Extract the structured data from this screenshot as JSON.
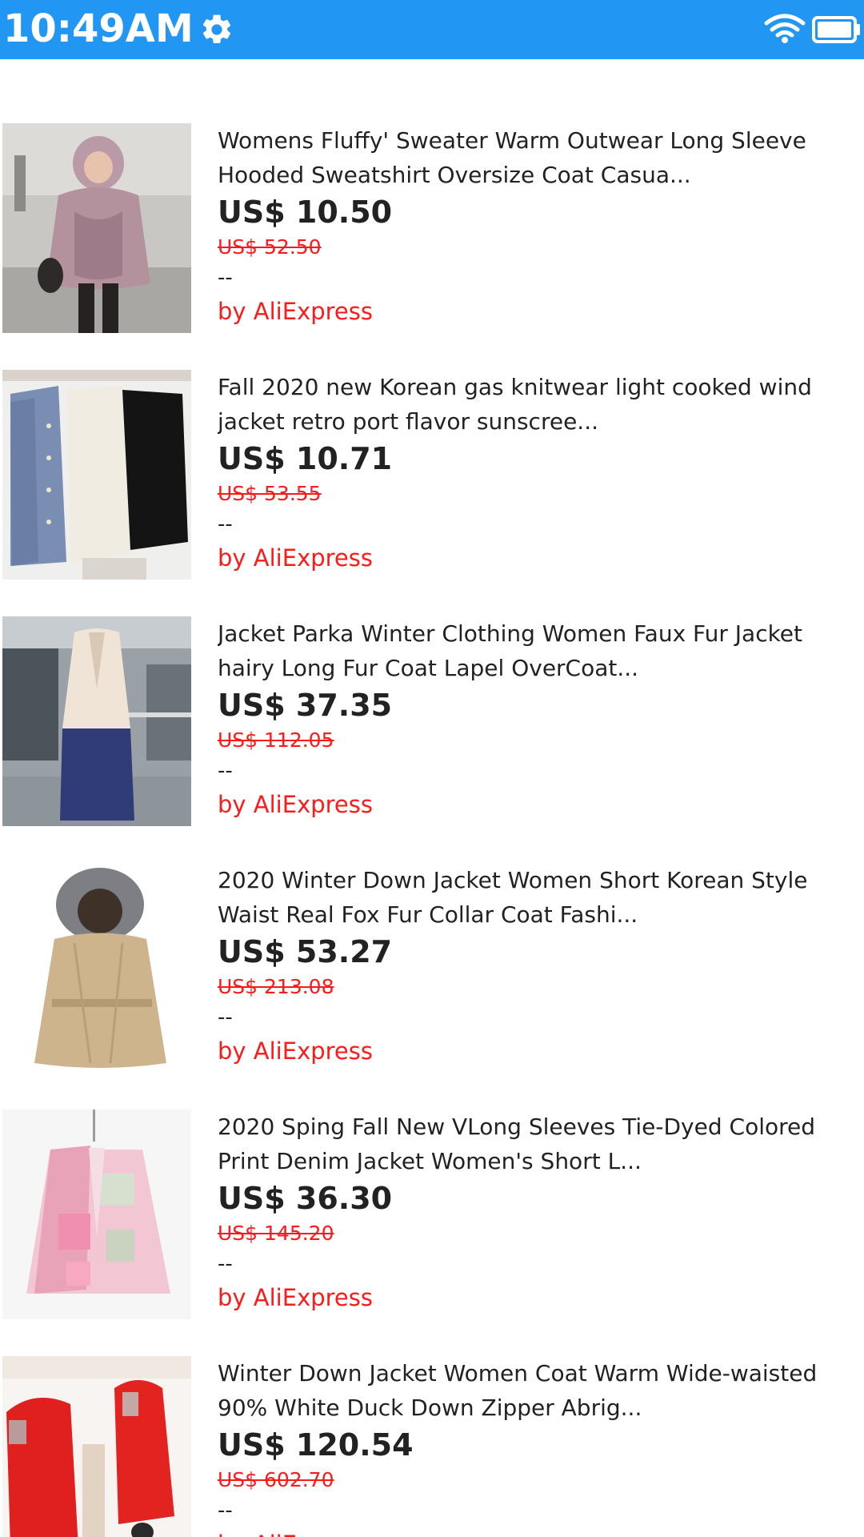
{
  "status_bar": {
    "time": "10:49AM",
    "background": "#2196f3",
    "icons": [
      "gear-icon",
      "wifi-icon",
      "battery-icon"
    ]
  },
  "colors": {
    "price_accent": "#ff1a1a",
    "text": "#222222"
  },
  "products": [
    {
      "title": "Womens Fluffy' Sweater Warm Outwear Long Sleeve Hooded Sweatshirt Oversize Coat Casua...",
      "price": "US$ 10.50",
      "original_price": "US$ 52.50",
      "discount": "--",
      "seller": "by AliExpress"
    },
    {
      "title": "Fall 2020 new Korean gas knitwear light cooked wind jacket retro port flavor sunscree...",
      "price": "US$ 10.71",
      "original_price": "US$ 53.55",
      "discount": "--",
      "seller": "by AliExpress"
    },
    {
      "title": "Jacket Parka Winter Clothing Women Faux Fur Jacket hairy Long Fur Coat Lapel OverCoat...",
      "price": "US$ 37.35",
      "original_price": "US$ 112.05",
      "discount": "--",
      "seller": "by AliExpress"
    },
    {
      "title": "2020 Winter Down Jacket Women Short Korean Style Waist Real Fox Fur Collar Coat Fashi...",
      "price": "US$ 53.27",
      "original_price": "US$ 213.08",
      "discount": "--",
      "seller": "by AliExpress"
    },
    {
      "title": "2020 Sping Fall New VLong Sleeves Tie-Dyed Colored Print Denim Jacket Women's Short L...",
      "price": "US$ 36.30",
      "original_price": "US$ 145.20",
      "discount": "--",
      "seller": "by AliExpress"
    },
    {
      "title": "Winter Down Jacket Women Coat Warm Wide-waisted 90% White Duck Down Zipper Abrig...",
      "price": "US$ 120.54",
      "original_price": "US$ 602.70",
      "discount": "--",
      "seller": "by AliExpress"
    }
  ]
}
